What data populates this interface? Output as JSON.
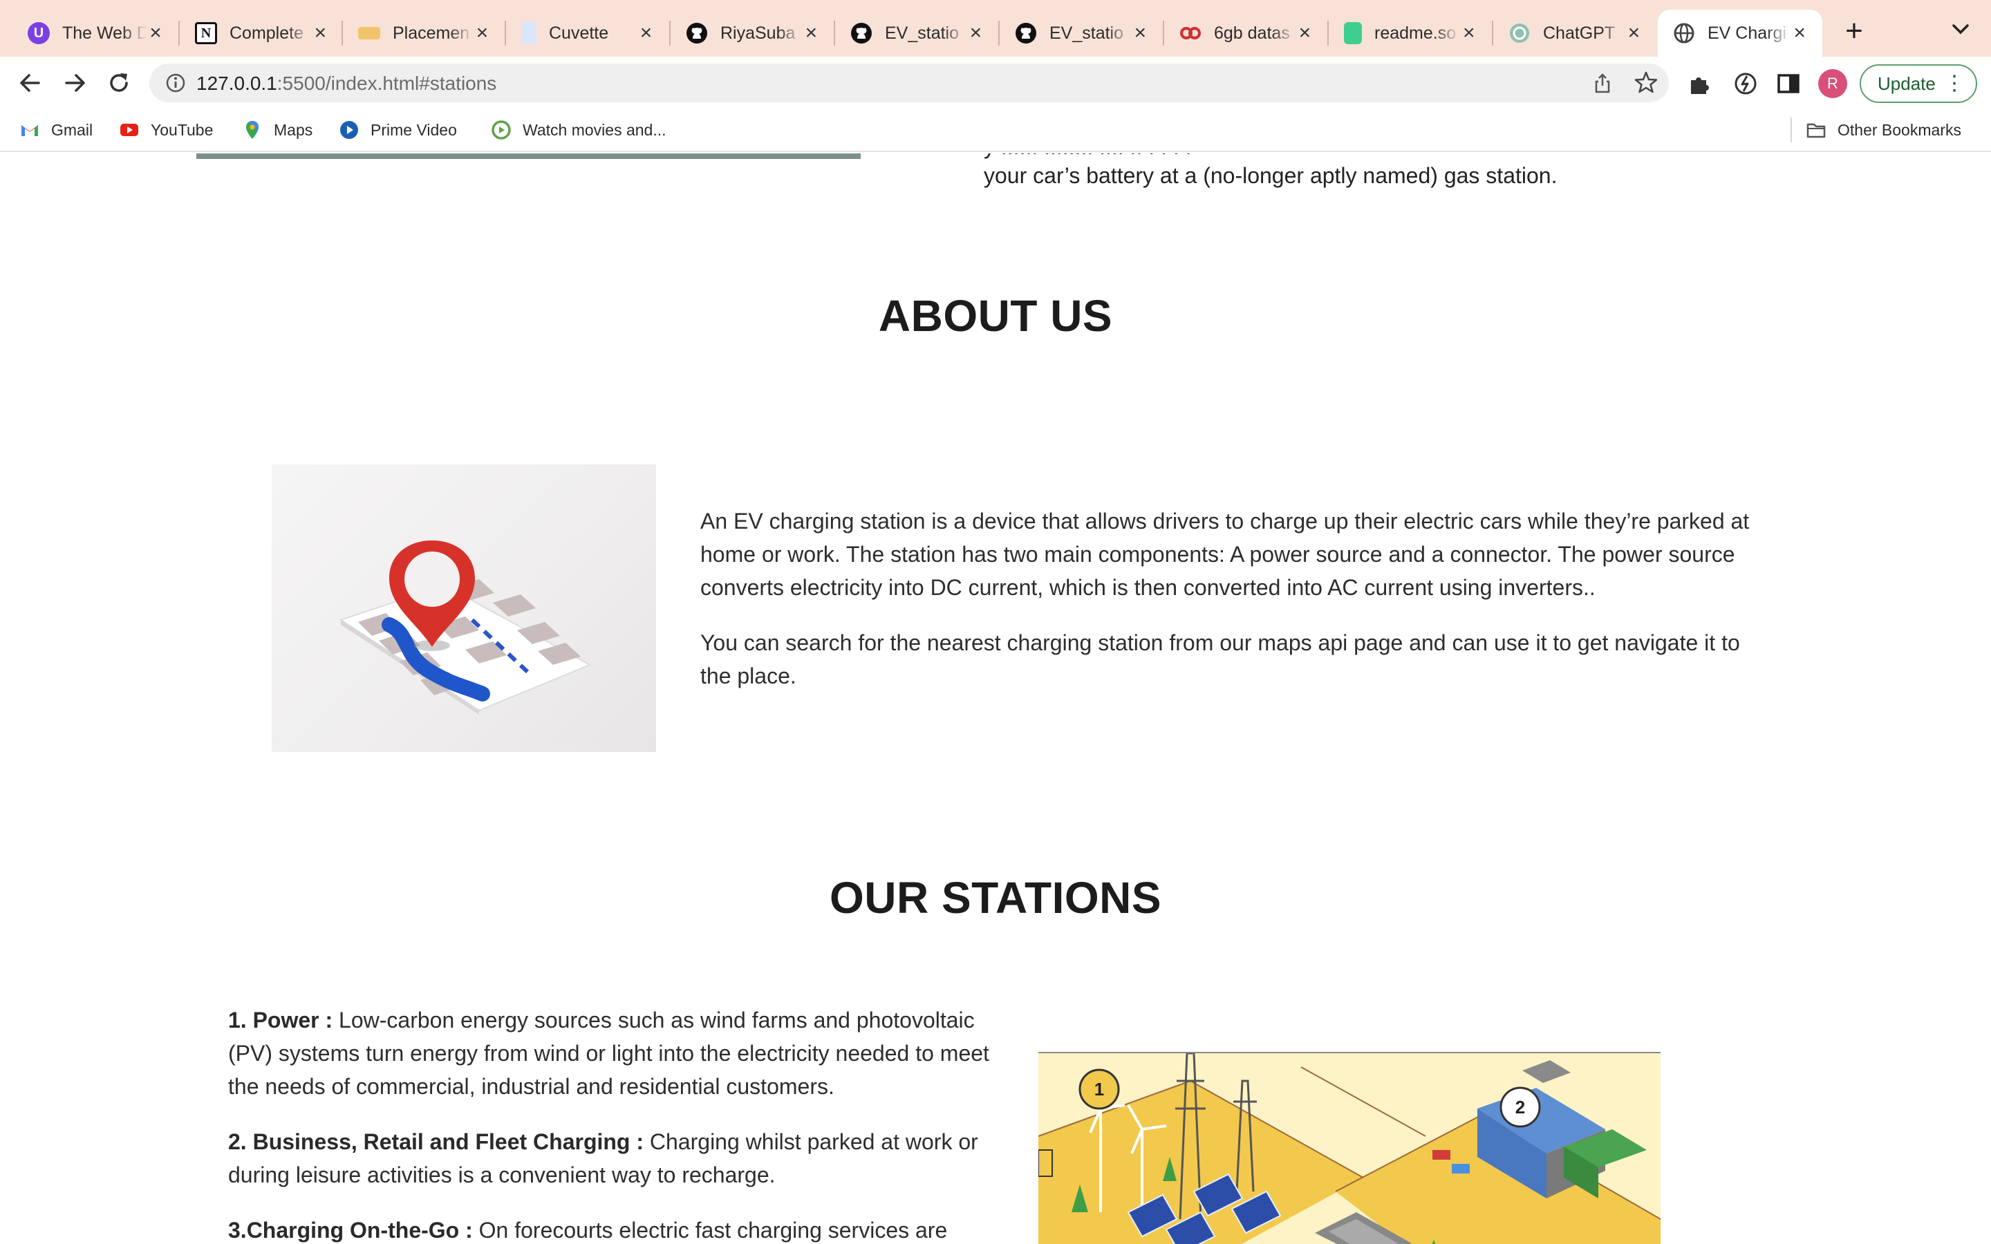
{
  "browser": {
    "tabs": [
      {
        "title": "The Web D",
        "icon": "u-logo-icon",
        "color": "#7b3fe4"
      },
      {
        "title": "Complete",
        "icon": "notion-icon",
        "color": "#111111"
      },
      {
        "title": "Placemen",
        "icon": "placement-icon",
        "color": "#c58b2b"
      },
      {
        "title": "Cuvette",
        "icon": "cuvette-icon",
        "color": "#3b6fd8"
      },
      {
        "title": "RiyaSuba",
        "icon": "github-icon",
        "color": "#111111"
      },
      {
        "title": "EV_statio",
        "icon": "github-icon",
        "color": "#111111"
      },
      {
        "title": "EV_statio",
        "icon": "github-icon",
        "color": "#111111"
      },
      {
        "title": "6gb datas",
        "icon": "infinity-icon",
        "color": "#d32f2f"
      },
      {
        "title": "readme.so",
        "icon": "readme-icon",
        "color": "#3ecf8e"
      },
      {
        "title": "ChatGPT",
        "icon": "chatgpt-icon",
        "color": "#5a9a8a"
      },
      {
        "title": "EV Chargi",
        "icon": "globe-icon",
        "color": "#444444",
        "active": true
      }
    ],
    "url_host": "127.0.0.1",
    "url_path": ":5500/index.html#stations",
    "update_label": "Update",
    "avatar_letter": "R",
    "bookmarks": [
      {
        "label": "Gmail",
        "icon": "gmail-icon"
      },
      {
        "label": "YouTube",
        "icon": "youtube-icon"
      },
      {
        "label": "Maps",
        "icon": "maps-icon"
      },
      {
        "label": "Prime Video",
        "icon": "prime-video-icon"
      },
      {
        "label": "Watch movies and...",
        "icon": "play-icon"
      }
    ],
    "other_bookmarks_label": "Other Bookmarks"
  },
  "page": {
    "prev_text_cut": "y ...... ........ .... .. . . . .",
    "prev_text_tail": "your car’s battery at a (no-longer aptly named) gas station.",
    "about": {
      "title": "ABOUT US",
      "paragraph1": "An EV charging station is a device that allows drivers to charge up their electric cars while they’re parked at home or work. The station has two main components: A power source and a connector. The power source converts electricity into DC current, which is then converted into AC current using inverters..",
      "paragraph2": "You can search for the nearest charging station from our maps api page and can use it to get navigate it to the place."
    },
    "stations": {
      "title": "OUR STATIONS",
      "items": [
        {
          "heading": "1. Power :",
          "text": " Low-carbon energy sources such as wind farms and photovoltaic (PV) systems turn energy from wind or light into the electricity needed to meet the needs of commercial, industrial and residential customers."
        },
        {
          "heading": "2. Business, Retail and Fleet Charging :",
          "text": " Charging whilst parked at work or during leisure activities is a convenient way to recharge."
        },
        {
          "heading": "3.Charging On-the-Go :",
          "text": " On forecourts electric fast charging services are"
        }
      ],
      "illustration_badges": [
        "1",
        "2"
      ]
    }
  }
}
